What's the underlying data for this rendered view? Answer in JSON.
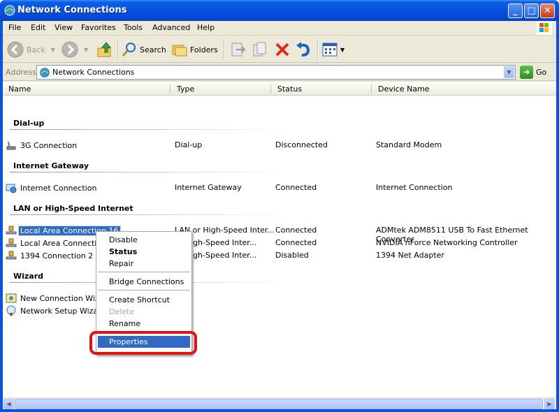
{
  "window": {
    "title": "Network Connections"
  },
  "menu": [
    "File",
    "Edit",
    "View",
    "Favorites",
    "Tools",
    "Advanced",
    "Help"
  ],
  "toolbar": {
    "back": "Back",
    "search": "Search",
    "folders": "Folders"
  },
  "address": {
    "label": "Address",
    "value": "Network Connections",
    "go": "Go"
  },
  "columns": [
    "Name",
    "Type",
    "Status",
    "Device Name"
  ],
  "groups": {
    "dialup": "Dial-up",
    "gateway": "Internet Gateway",
    "lan": "LAN or High-Speed Internet",
    "wizard": "Wizard"
  },
  "rows": {
    "g3": {
      "name": "3G Connection",
      "type": "Dial-up",
      "status": "Disconnected",
      "device": "Standard Modem"
    },
    "inet": {
      "name": "Internet Connection",
      "type": "Internet Gateway",
      "status": "Connected",
      "device": "Internet Connection"
    },
    "lac16": {
      "name": "Local Area Connection 16",
      "type": "LAN or High-Speed Inter...",
      "status": "Connected",
      "device": "ADMtek ADM8511 USB To Fast Ethernet Converter"
    },
    "lac": {
      "name": "Local Area Connection",
      "type": "or High-Speed Inter...",
      "status": "Connected",
      "device": "NVIDIA nForce Networking Controller"
    },
    "c1394": {
      "name": "1394 Connection 2",
      "type": "or High-Speed Inter...",
      "status": "Disabled",
      "device": "1394 Net Adapter"
    },
    "ncw": {
      "name": "New Connection Wizard",
      "type": "ard"
    },
    "nsw": {
      "name": "Network Setup Wizard",
      "type": "ard"
    }
  },
  "context_menu": {
    "disable": "Disable",
    "status": "Status",
    "repair": "Repair",
    "bridge": "Bridge Connections",
    "shortcut": "Create Shortcut",
    "delete": "Delete",
    "rename": "Rename",
    "properties": "Properties"
  },
  "colors": {
    "selection": "#316ac5",
    "highlight_ring": "#e3121a",
    "titlebar": "#0553e0"
  }
}
